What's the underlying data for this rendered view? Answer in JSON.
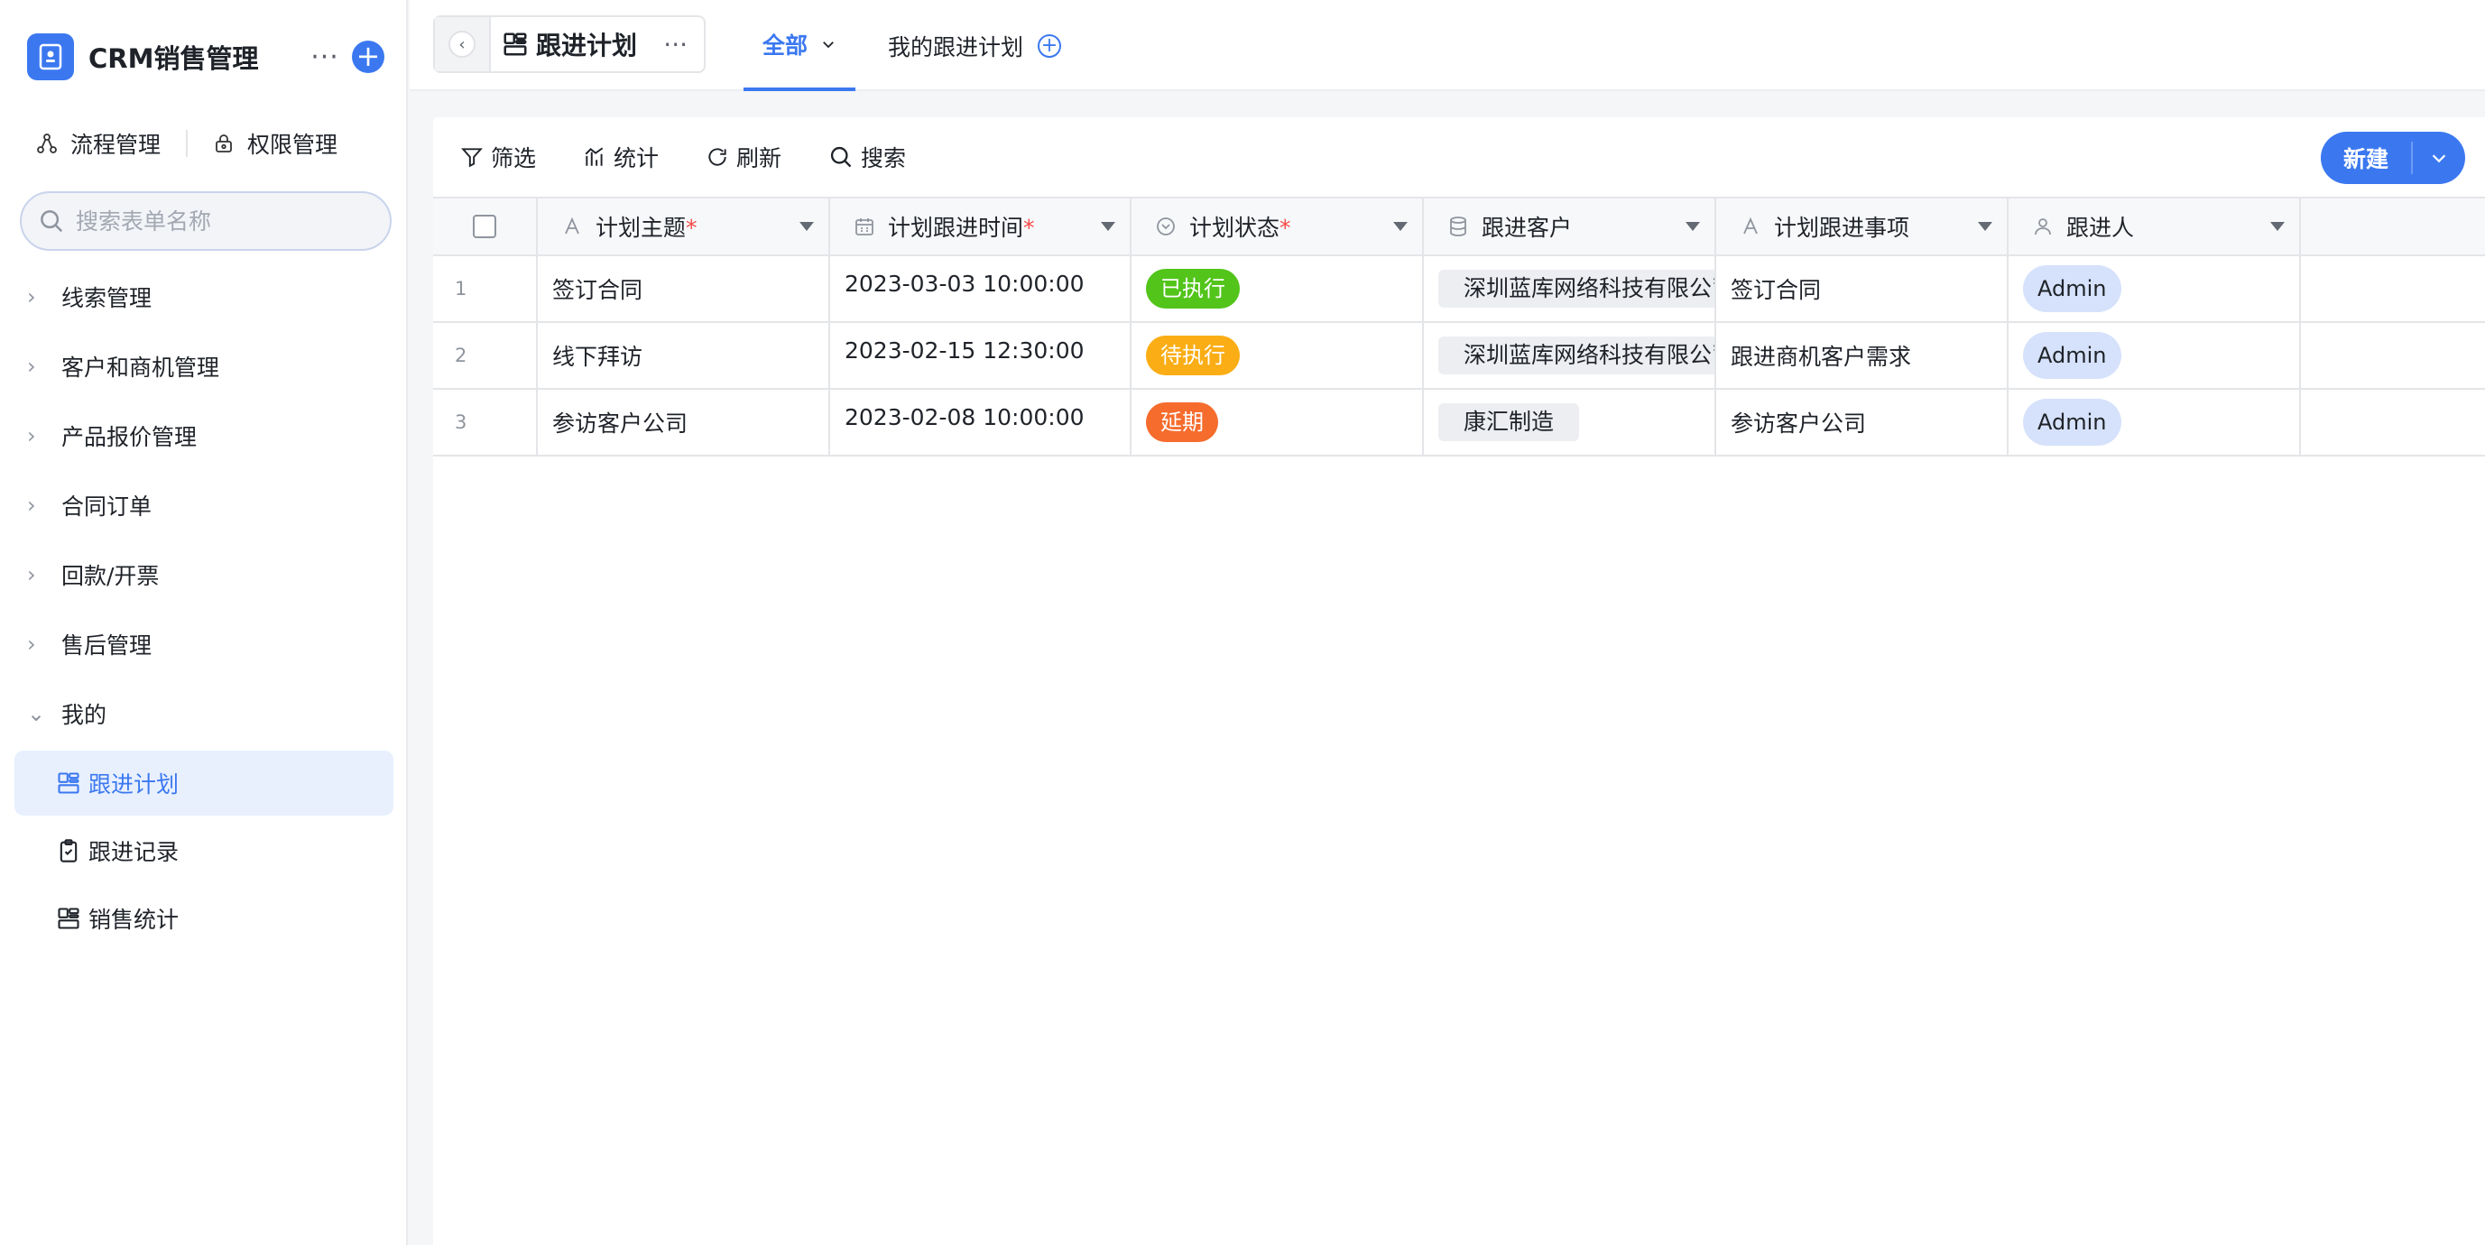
{
  "app": {
    "title": "CRM销售管理",
    "more": "···",
    "add": "+"
  },
  "mgmt": {
    "process": "流程管理",
    "permission": "权限管理"
  },
  "search": {
    "placeholder": "搜索表单名称"
  },
  "nav": {
    "items": [
      {
        "label": "线索管理"
      },
      {
        "label": "客户和商机管理"
      },
      {
        "label": "产品报价管理"
      },
      {
        "label": "合同订单"
      },
      {
        "label": "回款/开票"
      },
      {
        "label": "售后管理"
      }
    ],
    "mine": {
      "label": "我的",
      "children": [
        {
          "label": "跟进计划",
          "active": true
        },
        {
          "label": "跟进记录"
        },
        {
          "label": "销售统计"
        }
      ]
    }
  },
  "topbar": {
    "page_title": "跟进计划",
    "page_more": "···",
    "tabs": [
      {
        "label": "全部",
        "active": true
      },
      {
        "label": "我的跟进计划"
      }
    ],
    "add_view": "+"
  },
  "toolbar": {
    "filter": "筛选",
    "stats": "统计",
    "refresh": "刷新",
    "search": "搜索",
    "new": "新建"
  },
  "table": {
    "columns": [
      {
        "name": "计划主题",
        "required": "*"
      },
      {
        "name": "计划跟进时间",
        "required": "*"
      },
      {
        "name": "计划状态",
        "required": "*"
      },
      {
        "name": "跟进客户",
        "required": ""
      },
      {
        "name": "计划跟进事项",
        "required": ""
      },
      {
        "name": "跟进人",
        "required": ""
      }
    ],
    "rows": [
      {
        "index": "1",
        "subject": "签订合同",
        "time": "2023-03-03 10:00:00",
        "status": "已执行",
        "status_color": "#52c41a",
        "customer": "深圳蓝库网络科技有限公司",
        "item": "签订合同",
        "owner": "Admin"
      },
      {
        "index": "2",
        "subject": "线下拜访",
        "time": "2023-02-15 12:30:00",
        "status": "待执行",
        "status_color": "#faad14",
        "customer": "深圳蓝库网络科技有限公司",
        "item": "跟进商机客户需求",
        "owner": "Admin"
      },
      {
        "index": "3",
        "subject": "参访客户公司",
        "time": "2023-02-08 10:00:00",
        "status": "延期",
        "status_color": "#f56c2d",
        "customer": "康汇制造",
        "item": "参访客户公司",
        "owner": "Admin"
      }
    ]
  },
  "colors": {
    "accent": "#3b78f0",
    "active_bg": "#e8f0fe"
  }
}
